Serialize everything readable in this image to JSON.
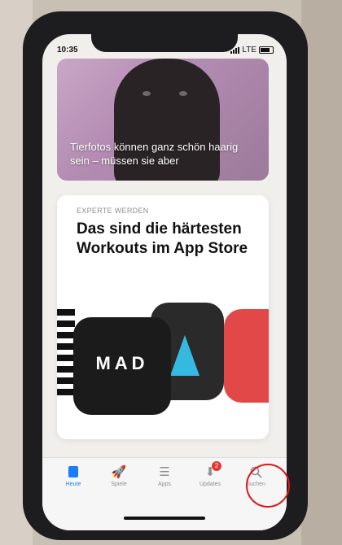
{
  "status_bar": {
    "time": "10:35",
    "network": "LTE"
  },
  "featured_card": {
    "caption": "Tierfotos können ganz schön haarig sein – müssen sie aber"
  },
  "story_card": {
    "eyebrow": "EXPERTE WERDEN",
    "headline": "Das sind die härtesten Workouts im App Store",
    "app_tile_label": "MAD"
  },
  "tab_bar": {
    "tabs": [
      {
        "label": "Heute",
        "icon": "today-icon",
        "active": true
      },
      {
        "label": "Spiele",
        "icon": "rocket-icon"
      },
      {
        "label": "Apps",
        "icon": "apps-stack-icon"
      },
      {
        "label": "Updates",
        "icon": "download-icon",
        "badge": "2"
      },
      {
        "label": "Suchen",
        "icon": "search-icon"
      }
    ]
  },
  "colors": {
    "accent": "#1b7cf5",
    "badge": "#e5352f",
    "annotation": "#d91a1a"
  }
}
